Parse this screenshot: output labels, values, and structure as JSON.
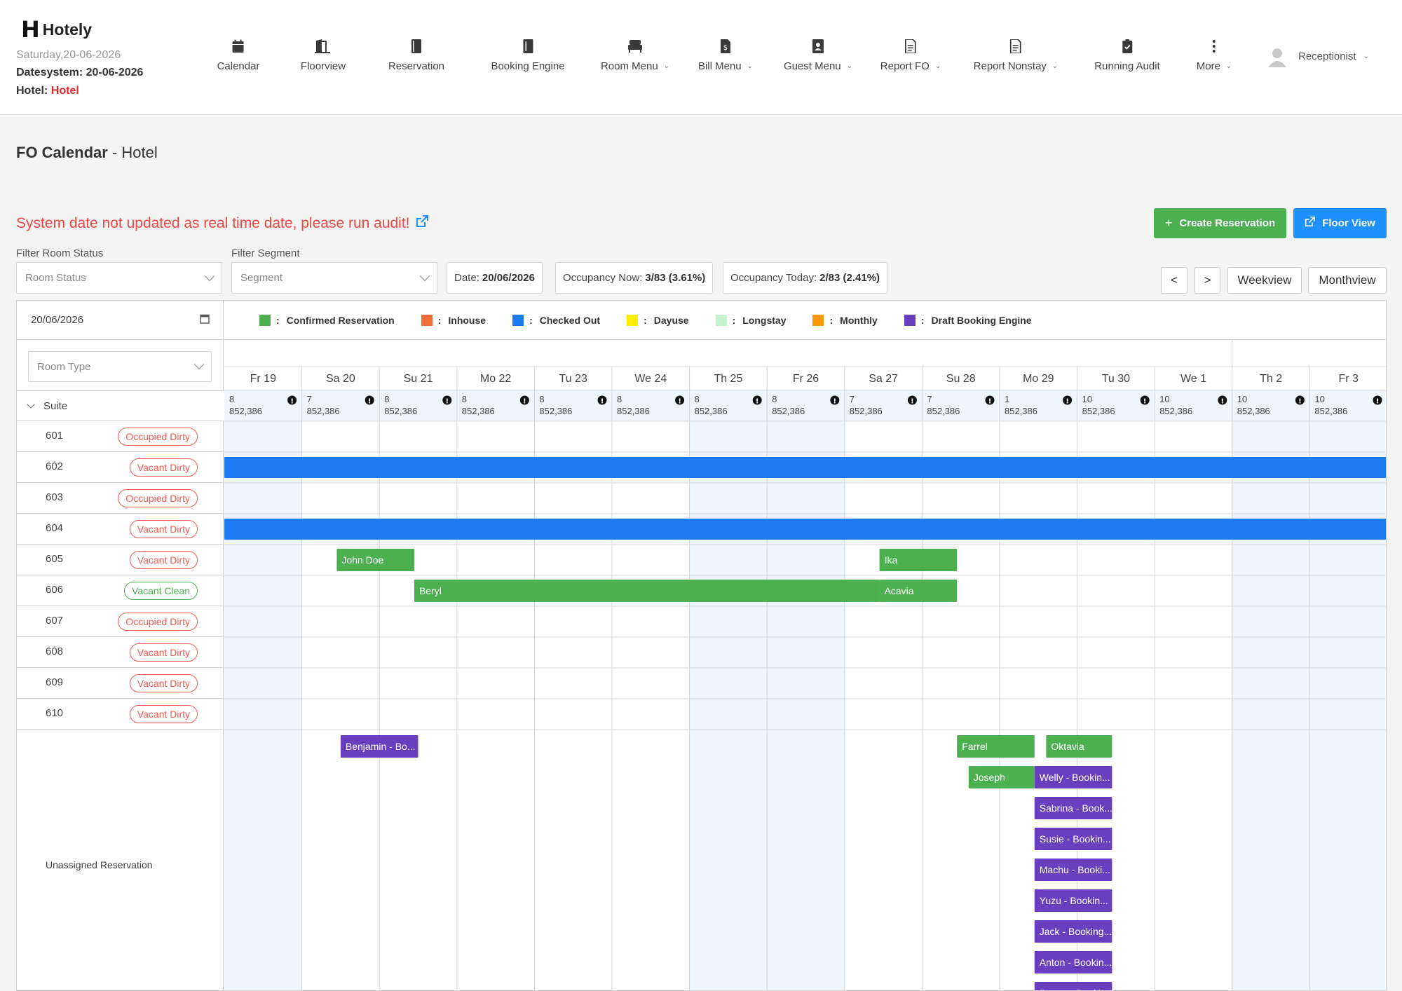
{
  "app": {
    "brand_mark": "H",
    "brand_name": "Hotely"
  },
  "header": {
    "date_line": "Saturday,20-06-2026",
    "datesystem": "Datesystem: 20-06-2026",
    "hotel_label": "Hotel: ",
    "hotel_value": "Hotel",
    "user": "Receptionist"
  },
  "nav": [
    {
      "label": "Calendar",
      "icon": "calendar-icon",
      "dropdown": false
    },
    {
      "label": "Floorview",
      "icon": "door-icon",
      "dropdown": false
    },
    {
      "label": "Reservation",
      "icon": "notebook-icon",
      "dropdown": false
    },
    {
      "label": "Booking Engine",
      "icon": "book-icon",
      "dropdown": false
    },
    {
      "label": "Room Menu",
      "icon": "bed-icon",
      "dropdown": true
    },
    {
      "label": "Bill Menu",
      "icon": "bill-icon",
      "dropdown": true
    },
    {
      "label": "Guest Menu",
      "icon": "contact-icon",
      "dropdown": true
    },
    {
      "label": "Report FO",
      "icon": "report-icon",
      "dropdown": true
    },
    {
      "label": "Report Nonstay",
      "icon": "report-icon",
      "dropdown": true
    },
    {
      "label": "Running Audit",
      "icon": "clipboard-check-icon",
      "dropdown": false
    },
    {
      "label": "More",
      "icon": "more-vertical-icon",
      "dropdown": true
    }
  ],
  "page": {
    "title_bold": "FO Calendar",
    "title_rest": " - Hotel",
    "alert": "System date not updated as real time date, please run audit!",
    "create_btn": "Create Reservation",
    "floor_btn": "Floor View"
  },
  "filters": {
    "room_status_label": "Filter Room Status",
    "room_status_placeholder": "Room Status",
    "segment_label": "Filter Segment",
    "segment_placeholder": "Segment",
    "date_label": "Date:",
    "date_value": "20/06/2026",
    "occ_now_label": "Occupancy Now:",
    "occ_now_value": "3/83 (3.61%)",
    "occ_today_label": "Occupancy Today:",
    "occ_today_value": "2/83 (2.41%)",
    "prev": "<",
    "next": ">",
    "weekview": "Weekview",
    "monthview": "Monthview"
  },
  "calendar": {
    "date_input": "20/06/2026",
    "room_type_placeholder": "Room Type",
    "group": "Suite",
    "unassigned_label": "Unassigned Reservation",
    "legend": [
      {
        "label": "Confirmed Reservation",
        "color": "#4caf50"
      },
      {
        "label": "Inhouse",
        "color": "#f26b3a"
      },
      {
        "label": "Checked Out",
        "color": "#1e7bf2"
      },
      {
        "label": "Dayuse",
        "color": "#ffee00"
      },
      {
        "label": "Longstay",
        "color": "#c6f1cf"
      },
      {
        "label": "Monthly",
        "color": "#ff9800"
      },
      {
        "label": "Draft Booking Engine",
        "color": "#6a3fbf"
      }
    ],
    "days": [
      {
        "label": "Fr 19",
        "count": "8",
        "price": "852,386"
      },
      {
        "label": "Sa 20",
        "count": "7",
        "price": "852,386"
      },
      {
        "label": "Su 21",
        "count": "8",
        "price": "852,386"
      },
      {
        "label": "Mo 22",
        "count": "8",
        "price": "852,386"
      },
      {
        "label": "Tu 23",
        "count": "8",
        "price": "852,386"
      },
      {
        "label": "We 24",
        "count": "8",
        "price": "852,386"
      },
      {
        "label": "Th 25",
        "count": "8",
        "price": "852,386"
      },
      {
        "label": "Fr 26",
        "count": "8",
        "price": "852,386"
      },
      {
        "label": "Sa 27",
        "count": "7",
        "price": "852,386"
      },
      {
        "label": "Su 28",
        "count": "7",
        "price": "852,386"
      },
      {
        "label": "Mo 29",
        "count": "1",
        "price": "852,386"
      },
      {
        "label": "Tu 30",
        "count": "10",
        "price": "852,386"
      },
      {
        "label": "We 1",
        "count": "10",
        "price": "852,386"
      },
      {
        "label": "Th 2",
        "count": "10",
        "price": "852,386"
      },
      {
        "label": "Fr 3",
        "count": "10",
        "price": "852,386"
      }
    ],
    "rooms": [
      {
        "number": "601",
        "status": "Occupied Dirty",
        "tone": "dirty"
      },
      {
        "number": "602",
        "status": "Vacant Dirty",
        "tone": "dirty"
      },
      {
        "number": "603",
        "status": "Occupied Dirty",
        "tone": "dirty"
      },
      {
        "number": "604",
        "status": "Vacant Dirty",
        "tone": "dirty"
      },
      {
        "number": "605",
        "status": "Vacant Dirty",
        "tone": "dirty"
      },
      {
        "number": "606",
        "status": "Vacant Clean",
        "tone": "clean"
      },
      {
        "number": "607",
        "status": "Occupied Dirty",
        "tone": "dirty"
      },
      {
        "number": "608",
        "status": "Vacant Dirty",
        "tone": "dirty"
      },
      {
        "number": "609",
        "status": "Vacant Dirty",
        "tone": "dirty"
      },
      {
        "number": "610",
        "status": "Vacant Dirty",
        "tone": "dirty"
      }
    ],
    "bookings": [
      {
        "room": "602",
        "label": "",
        "kind": "checked_out",
        "start": 0,
        "end": 15
      },
      {
        "room": "604",
        "label": "",
        "kind": "checked_out",
        "start": 0,
        "end": 15
      },
      {
        "room": "605",
        "label": "John Doe",
        "kind": "confirmed",
        "start": 1.45,
        "end": 2.45
      },
      {
        "room": "605",
        "label": "Ika",
        "kind": "confirmed",
        "start": 8.45,
        "end": 9.45
      },
      {
        "room": "606",
        "label": "Beryl",
        "kind": "confirmed",
        "start": 2.45,
        "end": 8.45
      },
      {
        "room": "606",
        "label": "Acavia",
        "kind": "confirmed",
        "start": 8.45,
        "end": 9.45
      }
    ],
    "unassigned": [
      {
        "label": "Benjamin - Bo...",
        "kind": "draft",
        "start": 1.5,
        "end": 2.5,
        "line": 0
      },
      {
        "label": "Farrel",
        "kind": "confirmed",
        "start": 9.45,
        "end": 10.45,
        "line": 0
      },
      {
        "label": "Oktavia",
        "kind": "confirmed",
        "start": 10.6,
        "end": 11.45,
        "line": 0
      },
      {
        "label": "Joseph",
        "kind": "confirmed",
        "start": 9.6,
        "end": 10.45,
        "line": 1
      },
      {
        "label": "Welly - Bookin...",
        "kind": "draft",
        "start": 10.45,
        "end": 11.45,
        "line": 1
      },
      {
        "label": "Sabrina - Book...",
        "kind": "draft",
        "start": 10.45,
        "end": 11.45,
        "line": 2
      },
      {
        "label": "Susie - Bookin...",
        "kind": "draft",
        "start": 10.45,
        "end": 11.45,
        "line": 3
      },
      {
        "label": "Machu - Booki...",
        "kind": "draft",
        "start": 10.45,
        "end": 11.45,
        "line": 4
      },
      {
        "label": "Yuzu - Bookin...",
        "kind": "draft",
        "start": 10.45,
        "end": 11.45,
        "line": 5
      },
      {
        "label": "Jack - Booking...",
        "kind": "draft",
        "start": 10.45,
        "end": 11.45,
        "line": 6
      },
      {
        "label": "Anton - Bookin...",
        "kind": "draft",
        "start": 10.45,
        "end": 11.45,
        "line": 7
      },
      {
        "label": "Benny - Booki...",
        "kind": "draft",
        "start": 10.45,
        "end": 11.45,
        "line": 8
      }
    ],
    "weekend_columns": [
      0,
      6,
      7,
      13,
      14
    ],
    "colors": {
      "confirmed": "#4caf50",
      "checked_out": "#1e7bf2",
      "draft": "#6a3fbf",
      "weekend": "#eef5fb",
      "grid": "#d4d4d4"
    }
  }
}
